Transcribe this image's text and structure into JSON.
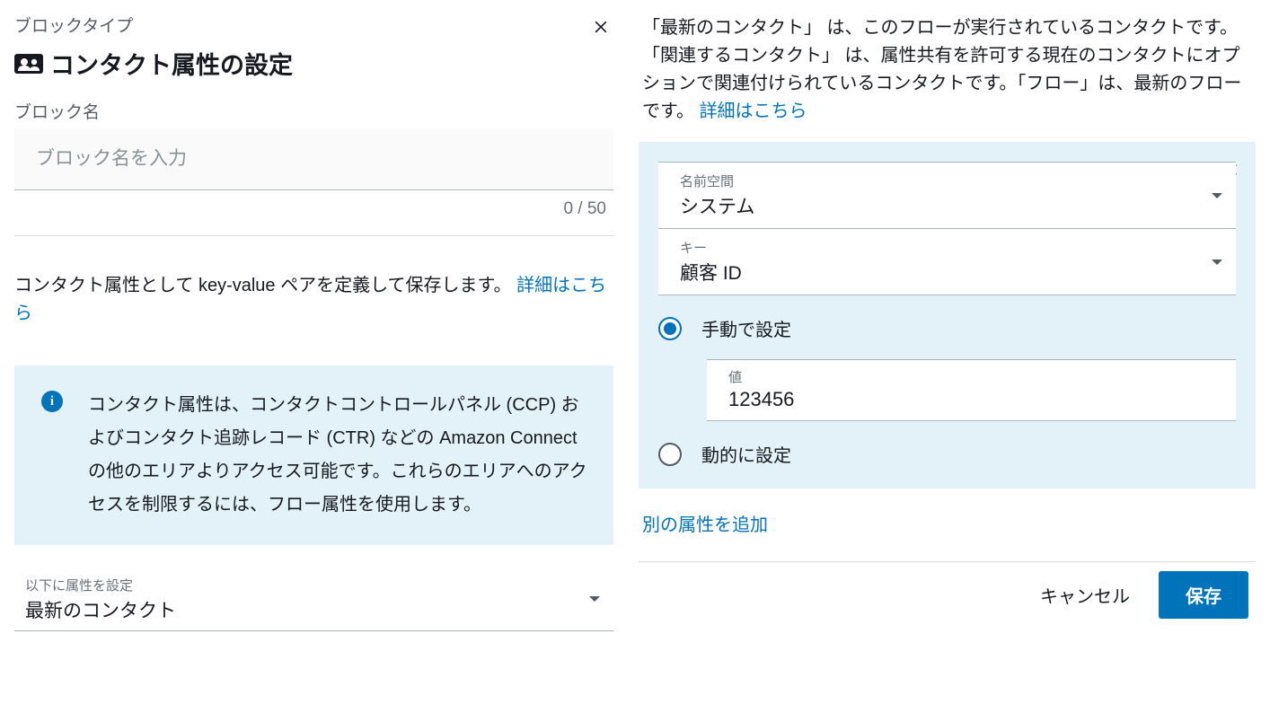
{
  "left": {
    "block_type_label": "ブロックタイプ",
    "title": "コンタクト属性の設定",
    "block_name_label": "ブロック名",
    "block_name_placeholder": "ブロック名を入力",
    "char_counter": "0 / 50",
    "desc": "コンタクト属性として key-value ペアを定義して保存します。",
    "desc_link": "詳細はこちら",
    "info_text": "コンタクト属性は、コンタクトコントロールパネル (CCP) およびコンタクト追跡レコード (CTR) などの Amazon Connect の他のエリアよりアクセス可能です。これらのエリアへのアクセスを制限するには、フロー属性を使用します。",
    "target_select_label": "以下に属性を設定",
    "target_select_value": "最新のコンタクト"
  },
  "right": {
    "desc": "「最新のコンタクト」 は、このフローが実行されているコンタクトです。「関連するコンタクト」 は、属性共有を許可する現在のコンタクトにオプションで関連付けられているコンタクトです。「フロー」は、最新のフローです。 ",
    "desc_link": "詳細はこちら",
    "namespace_label": "名前空間",
    "namespace_value": "システム",
    "key_label": "キー",
    "key_value": "顧客 ID",
    "radio_manual": "手動で設定",
    "radio_dynamic": "動的に設定",
    "value_field_label": "値",
    "value_field_value": "123456",
    "add_attribute": "別の属性を追加"
  },
  "footer": {
    "cancel": "キャンセル",
    "save": "保存"
  }
}
